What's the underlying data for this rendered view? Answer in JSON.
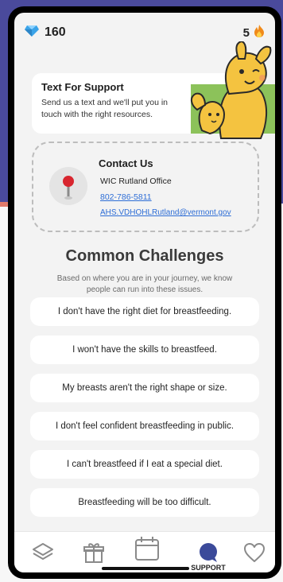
{
  "status_bar": {
    "gem_count": "160",
    "streak_count": "5"
  },
  "support_card": {
    "title": "Text For Support",
    "description": "Send us a text and we'll put you in touch with the right resources."
  },
  "contact": {
    "title": "Contact Us",
    "office": "WIC Rutland Office",
    "phone": "802-786-5811",
    "email": "AHS.VDHOHLRutland@vermont.gov"
  },
  "challenges": {
    "title": "Common Challenges",
    "subtitle": "Based on where you are in your journey, we know people can run into these issues.",
    "items": [
      "I don't have the right diet for breastfeeding.",
      "I won't have the skills to breastfeed.",
      "My breasts aren't the right shape or size.",
      "I don't feel confident breastfeeding in public.",
      "I can't breastfeed if I eat a special diet.",
      "Breastfeeding will be too difficult."
    ]
  },
  "nav": {
    "support_label": "SUPPORT"
  },
  "colors": {
    "accent_link": "#2d6dd6",
    "gem": "#3aa3e8",
    "flame": "#f08a1a",
    "pin": "#d8262f",
    "mascot": "#f4c340"
  }
}
